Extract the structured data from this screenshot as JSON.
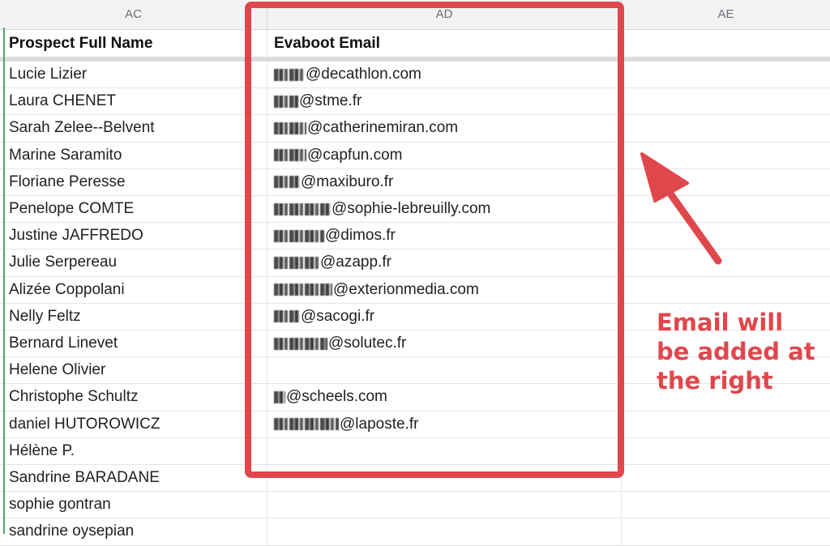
{
  "column_headers": [
    "AC",
    "AD",
    "AE"
  ],
  "header_row": {
    "name_header": "Prospect Full Name",
    "email_header": "Evaboot Email"
  },
  "rows": [
    {
      "name": "Lucie Lizier",
      "email_domain": "@decathlon.com",
      "email_redacted": true
    },
    {
      "name": "Laura CHENET",
      "email_domain": "@stme.fr",
      "email_redacted": true
    },
    {
      "name": "Sarah Zelee--Belvent",
      "email_domain": "@catherinemiran.com",
      "email_redacted": true
    },
    {
      "name": "Marine Saramito",
      "email_domain": "@capfun.com",
      "email_redacted": true
    },
    {
      "name": "Floriane Peresse",
      "email_domain": "@maxiburo.fr",
      "email_redacted": true
    },
    {
      "name": "Penelope COMTE",
      "email_domain": "@sophie-lebreuilly.com",
      "email_redacted": true
    },
    {
      "name": "Justine JAFFREDO",
      "email_domain": "@dimos.fr",
      "email_redacted": true
    },
    {
      "name": "Julie Serpereau",
      "email_domain": "@azapp.fr",
      "email_redacted": true
    },
    {
      "name": "Alizée Coppolani",
      "email_domain": "@exterionmedia.com",
      "email_redacted": true
    },
    {
      "name": "Nelly Feltz",
      "email_domain": "@sacogi.fr",
      "email_redacted": true
    },
    {
      "name": "Bernard Linevet",
      "email_domain": "@solutec.fr",
      "email_redacted": true
    },
    {
      "name": "Helene Olivier",
      "email_domain": "",
      "email_redacted": false
    },
    {
      "name": "Christophe Schultz",
      "email_domain": "@scheels.com",
      "email_redacted": true
    },
    {
      "name": "daniel HUTOROWICZ",
      "email_domain": "@laposte.fr",
      "email_redacted": true
    },
    {
      "name": "Hélène P.",
      "email_domain": "",
      "email_redacted": false
    },
    {
      "name": "Sandrine BARADANE",
      "email_domain": "",
      "email_redacted": false
    },
    {
      "name": "sophie gontran",
      "email_domain": "",
      "email_redacted": false
    },
    {
      "name": "sandrine oysepian",
      "email_domain": "",
      "email_redacted": false
    }
  ],
  "annotation": {
    "lines": [
      "Email will",
      "be added at",
      "the right"
    ],
    "color": "#e0474c"
  }
}
